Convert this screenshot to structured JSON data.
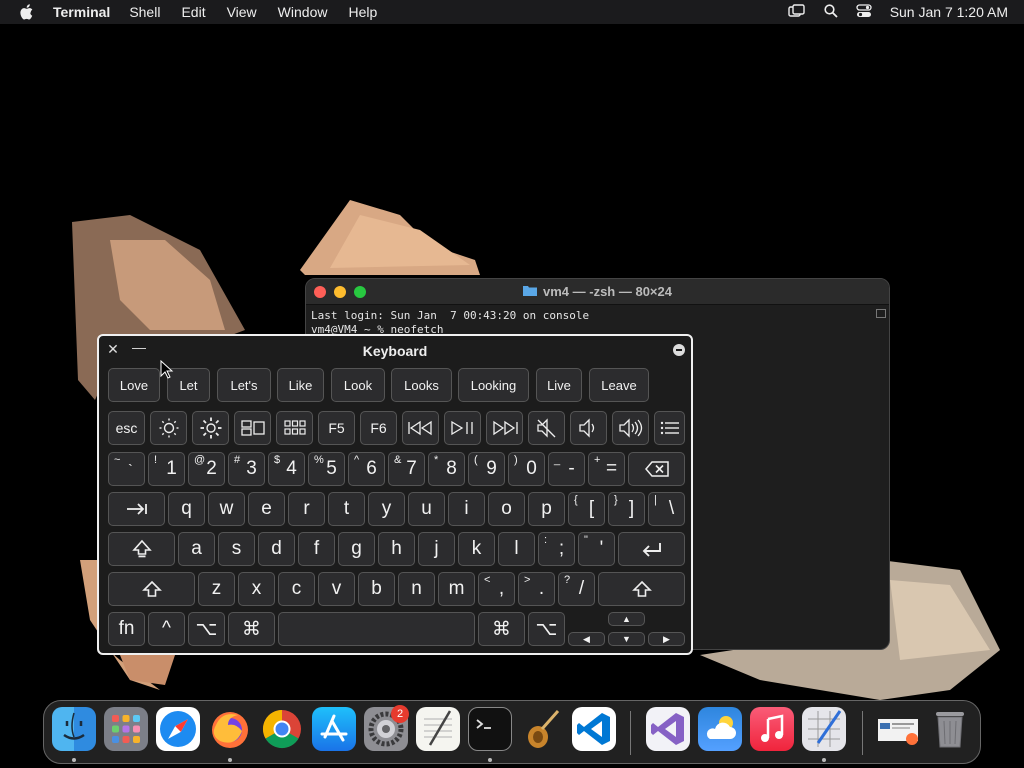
{
  "menubar": {
    "app_name": "Terminal",
    "items": [
      "Shell",
      "Edit",
      "View",
      "Window",
      "Help"
    ],
    "clock": "Sun Jan 7  1:20 AM"
  },
  "terminal": {
    "title": "vm4 — -zsh — 80×24",
    "lines": [
      "Last login: Sun Jan  7 00:43:20 on console",
      "vm4@VM4 ~ % neofetch"
    ]
  },
  "keyboard": {
    "title": "Keyboard",
    "suggestions": [
      "Love",
      "Let",
      "Let's",
      "Like",
      "Look",
      "Looks",
      "Looking",
      "Live",
      "Leave"
    ],
    "function_row": [
      "esc",
      "F5",
      "F6"
    ],
    "number_row": [
      {
        "sub": "~",
        "main": "`"
      },
      {
        "sub": "!",
        "main": "1"
      },
      {
        "sub": "@",
        "main": "2"
      },
      {
        "sub": "#",
        "main": "3"
      },
      {
        "sub": "$",
        "main": "4"
      },
      {
        "sub": "%",
        "main": "5"
      },
      {
        "sub": "^",
        "main": "6"
      },
      {
        "sub": "&",
        "main": "7"
      },
      {
        "sub": "*",
        "main": "8"
      },
      {
        "sub": "(",
        "main": "9"
      },
      {
        "sub": ")",
        "main": "0"
      },
      {
        "sub": "_",
        "main": "-"
      },
      {
        "sub": "+",
        "main": "="
      }
    ],
    "qwerty_row": [
      "q",
      "w",
      "e",
      "r",
      "t",
      "y",
      "u",
      "i",
      "o",
      "p"
    ],
    "qwerty_brackets": [
      {
        "sub": "{",
        "main": "["
      },
      {
        "sub": "}",
        "main": "]"
      },
      {
        "sub": "|",
        "main": "\\"
      }
    ],
    "home_row": [
      "a",
      "s",
      "d",
      "f",
      "g",
      "h",
      "j",
      "k",
      "l"
    ],
    "home_punct": [
      {
        "sub": ":",
        "main": ";"
      },
      {
        "sub": "\"",
        "main": "'"
      }
    ],
    "bottom_row": [
      "z",
      "x",
      "c",
      "v",
      "b",
      "n",
      "m"
    ],
    "bottom_punct": [
      {
        "sub": "<",
        "main": ","
      },
      {
        "sub": ">",
        "main": "."
      },
      {
        "sub": "?",
        "main": "/"
      }
    ],
    "modifier_row": {
      "fn": "fn",
      "ctrl": "^",
      "opt": "⌥",
      "cmd": "⌘",
      "cmd_right": "⌘",
      "opt_right": "⌥"
    }
  },
  "dock": {
    "settings_badge": "2",
    "apps": [
      "finder",
      "launchpad",
      "safari",
      "firefox",
      "chrome",
      "app-store",
      "system-settings",
      "textedit",
      "terminal",
      "instruments",
      "vscode",
      "visual-studio",
      "icloud",
      "music",
      "script-editor"
    ]
  },
  "colors": {
    "close": "#ff5f57",
    "minimize": "#febc2e",
    "zoom": "#28c840",
    "menubar": "#1b1b1d",
    "key_bg": "#2c2c2e"
  }
}
